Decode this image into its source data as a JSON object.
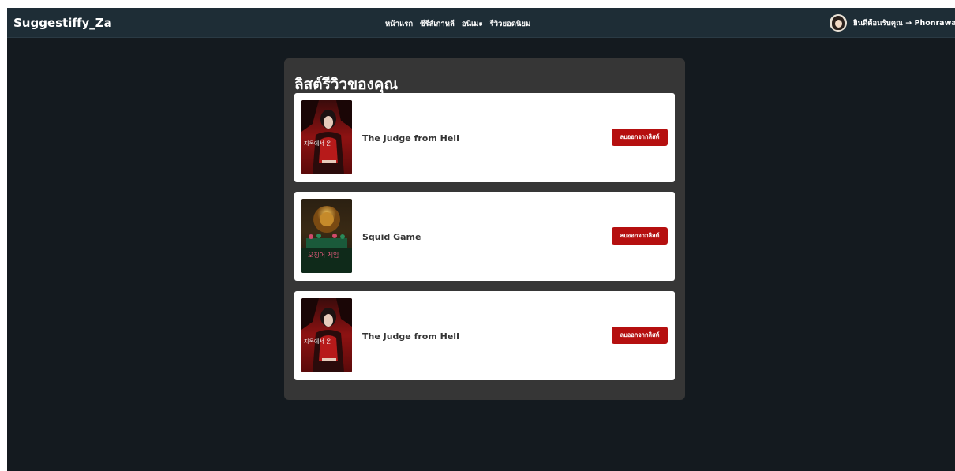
{
  "navbar": {
    "brand": "Suggestiffy_Za",
    "links": [
      {
        "label": "หน้าแรก"
      },
      {
        "label": "ซีรีส์เกาหลี"
      },
      {
        "label": "อนิเมะ"
      },
      {
        "label": "รีวิวยอดนิยม"
      }
    ],
    "welcome": "ยินดีต้อนรับคุณ → Phonrawat"
  },
  "panel": {
    "title": "ลิสต์รีวิวของคุณ",
    "items": [
      {
        "title": "The Judge from Hell",
        "remove_label": "ลบออกจากลิสต์",
        "poster_text": "지옥에서 온"
      },
      {
        "title": "Squid Game",
        "remove_label": "ลบออกจากลิสต์",
        "poster_text": "오징어 게임"
      },
      {
        "title": "The Judge from Hell",
        "remove_label": "ลบออกจากลิสต์",
        "poster_text": "지옥에서 온"
      }
    ]
  },
  "colors": {
    "page_bg": "#141a1f",
    "navbar_bg": "#1e2d36",
    "panel_bg": "#363636",
    "button_red": "#b50f0f"
  }
}
